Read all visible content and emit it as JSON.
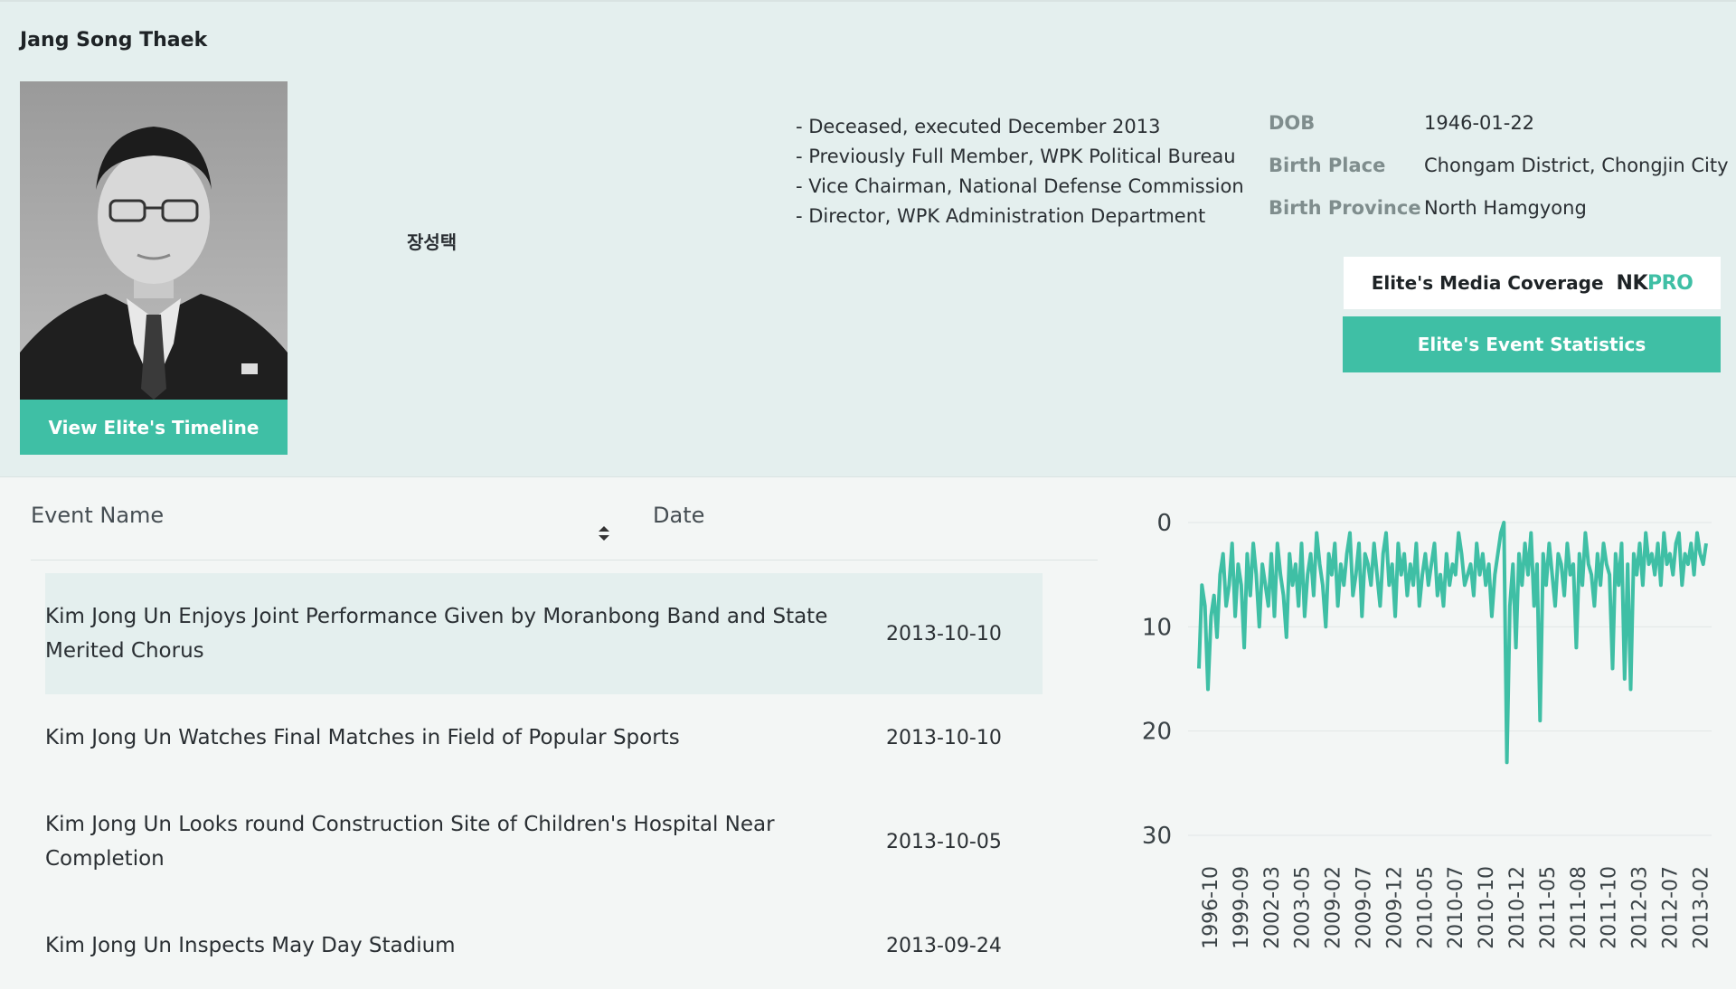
{
  "profile": {
    "name": "Jang Song Thaek",
    "korean_name": "장성택",
    "timeline_button": "View Elite's Timeline",
    "roles": [
      "- Deceased, executed December 2013",
      "- Previously Full Member, WPK Political Bureau",
      "- Vice Chairman, National Defense Commission",
      "- Director, WPK Administration Department"
    ],
    "info": [
      {
        "label": "DOB",
        "value": "1946-01-22"
      },
      {
        "label": "Birth Place",
        "value": "Chongam District, Chongjin City"
      },
      {
        "label": "Birth Province",
        "value": "North Hamgyong"
      }
    ],
    "media_button": "Elite's Media Coverage",
    "media_logo_a": "NK",
    "media_logo_b": "PRO",
    "stats_button": "Elite's Event Statistics"
  },
  "table": {
    "headers": {
      "event": "Event Name",
      "date": "Date"
    },
    "rows": [
      {
        "event": "Kim Jong Un Enjoys Joint Performance Given by Moranbong Band and State Merited Chorus",
        "date": "2013-10-10",
        "highlight": true
      },
      {
        "event": "Kim Jong Un Watches Final Matches in Field of Popular Sports",
        "date": "2013-10-10",
        "highlight": false
      },
      {
        "event": "Kim Jong Un Looks round Construction Site of Children's Hospital Near Completion",
        "date": "2013-10-05",
        "highlight": false
      },
      {
        "event": "Kim Jong Un Inspects May Day Stadium",
        "date": "2013-09-24",
        "highlight": false
      }
    ]
  },
  "colors": {
    "accent": "#3fbfa5",
    "panel": "#e4efee"
  },
  "chart_data": {
    "type": "line",
    "y_reversed": true,
    "ylim": [
      0,
      30
    ],
    "yticks": [
      0,
      10,
      20,
      30
    ],
    "grid": true,
    "xticks": [
      "1996-10",
      "1999-09",
      "2002-03",
      "2003-05",
      "2009-02",
      "2009-07",
      "2009-12",
      "2010-05",
      "2010-07",
      "2010-10",
      "2010-12",
      "2011-05",
      "2011-08",
      "2011-10",
      "2012-03",
      "2012-07",
      "2013-02"
    ],
    "series": [
      {
        "values": [
          14,
          6,
          8,
          16,
          9,
          7,
          11,
          5,
          3,
          8,
          6,
          2,
          9,
          4,
          6,
          12,
          3,
          7,
          2,
          5,
          10,
          4,
          6,
          8,
          3,
          9,
          2,
          5,
          7,
          11,
          3,
          6,
          4,
          8,
          2,
          9,
          5,
          3,
          7,
          1,
          4,
          6,
          10,
          3,
          5,
          2,
          8,
          4,
          6,
          3,
          1,
          7,
          5,
          2,
          9,
          3,
          4,
          6,
          2,
          5,
          8,
          3,
          1,
          6,
          4,
          9,
          2,
          5,
          3,
          7,
          4,
          6,
          2,
          8,
          5,
          3,
          6,
          4,
          2,
          7,
          5,
          8,
          3,
          6,
          4,
          5,
          1,
          3,
          6,
          5,
          4,
          7,
          2,
          5,
          3,
          6,
          4,
          9,
          5,
          3,
          1,
          0,
          23,
          8,
          4,
          12,
          3,
          6,
          2,
          5,
          1,
          8,
          4,
          19,
          3,
          6,
          2,
          5,
          8,
          3,
          4,
          7,
          2,
          5,
          4,
          12,
          3,
          6,
          1,
          4,
          5,
          8,
          3,
          6,
          2,
          4,
          5,
          14,
          3,
          6,
          2,
          15,
          4,
          16,
          3,
          5,
          2,
          6,
          1,
          4,
          3,
          5,
          2,
          6,
          1,
          4,
          3,
          5,
          2,
          1,
          6,
          3,
          4,
          2,
          5,
          1,
          3,
          4,
          2
        ]
      }
    ]
  }
}
